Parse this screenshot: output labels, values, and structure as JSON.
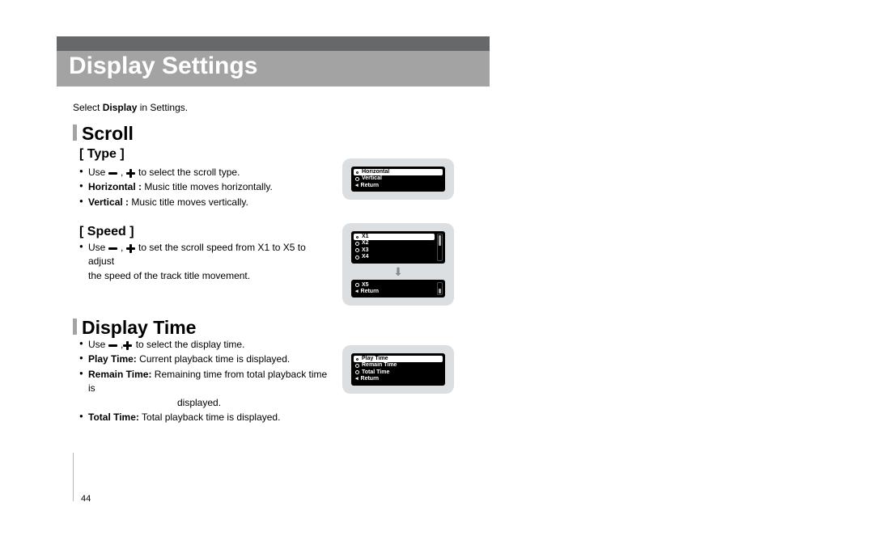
{
  "header": {
    "title": "Display Settings"
  },
  "intro": {
    "prefix": "Select ",
    "bold": "Display",
    "suffix": " in Settings."
  },
  "scroll": {
    "heading": "Scroll",
    "type": {
      "label": "[ Type ]",
      "use_prefix": "Use ",
      "use_mid": " , ",
      "use_suffix": " to select the scroll type.",
      "horizontal_label": "Horizontal :",
      "horizontal_desc": " Music title moves horizontally.",
      "vertical_label": "Vertical :",
      "vertical_desc": " Music title moves vertically.",
      "options": [
        "Horizontal",
        "Vertical",
        "Return"
      ],
      "selected": "Horizontal"
    },
    "speed": {
      "label": "[ Speed ]",
      "use_prefix": "Use ",
      "use_mid": " , ",
      "use_suffix_1": " to set the scroll speed from X1 to X5 to adjust",
      "use_suffix_2": "the speed of the track title movement.",
      "options_top": [
        "X1",
        "X2",
        "X3",
        "X4"
      ],
      "options_bottom": [
        "X5",
        "Return"
      ],
      "selected": "X1"
    }
  },
  "displayTime": {
    "heading": "Display Time",
    "use_prefix": "Use ",
    "use_mid": " ,",
    "use_suffix": " to select the display time.",
    "play_label": "Play Time:",
    "play_desc": " Current playback time is displayed.",
    "remain_label": "Remain Time:",
    "remain_desc_1": " Remaining time from total playback time is",
    "remain_desc_2": "displayed.",
    "total_label": "Total Time:",
    "total_desc": " Total playback time is displayed.",
    "options": [
      "Play Time",
      "Remain Time",
      "Total Time",
      "Return"
    ],
    "selected": "Play Time"
  },
  "pageNumber": "44"
}
